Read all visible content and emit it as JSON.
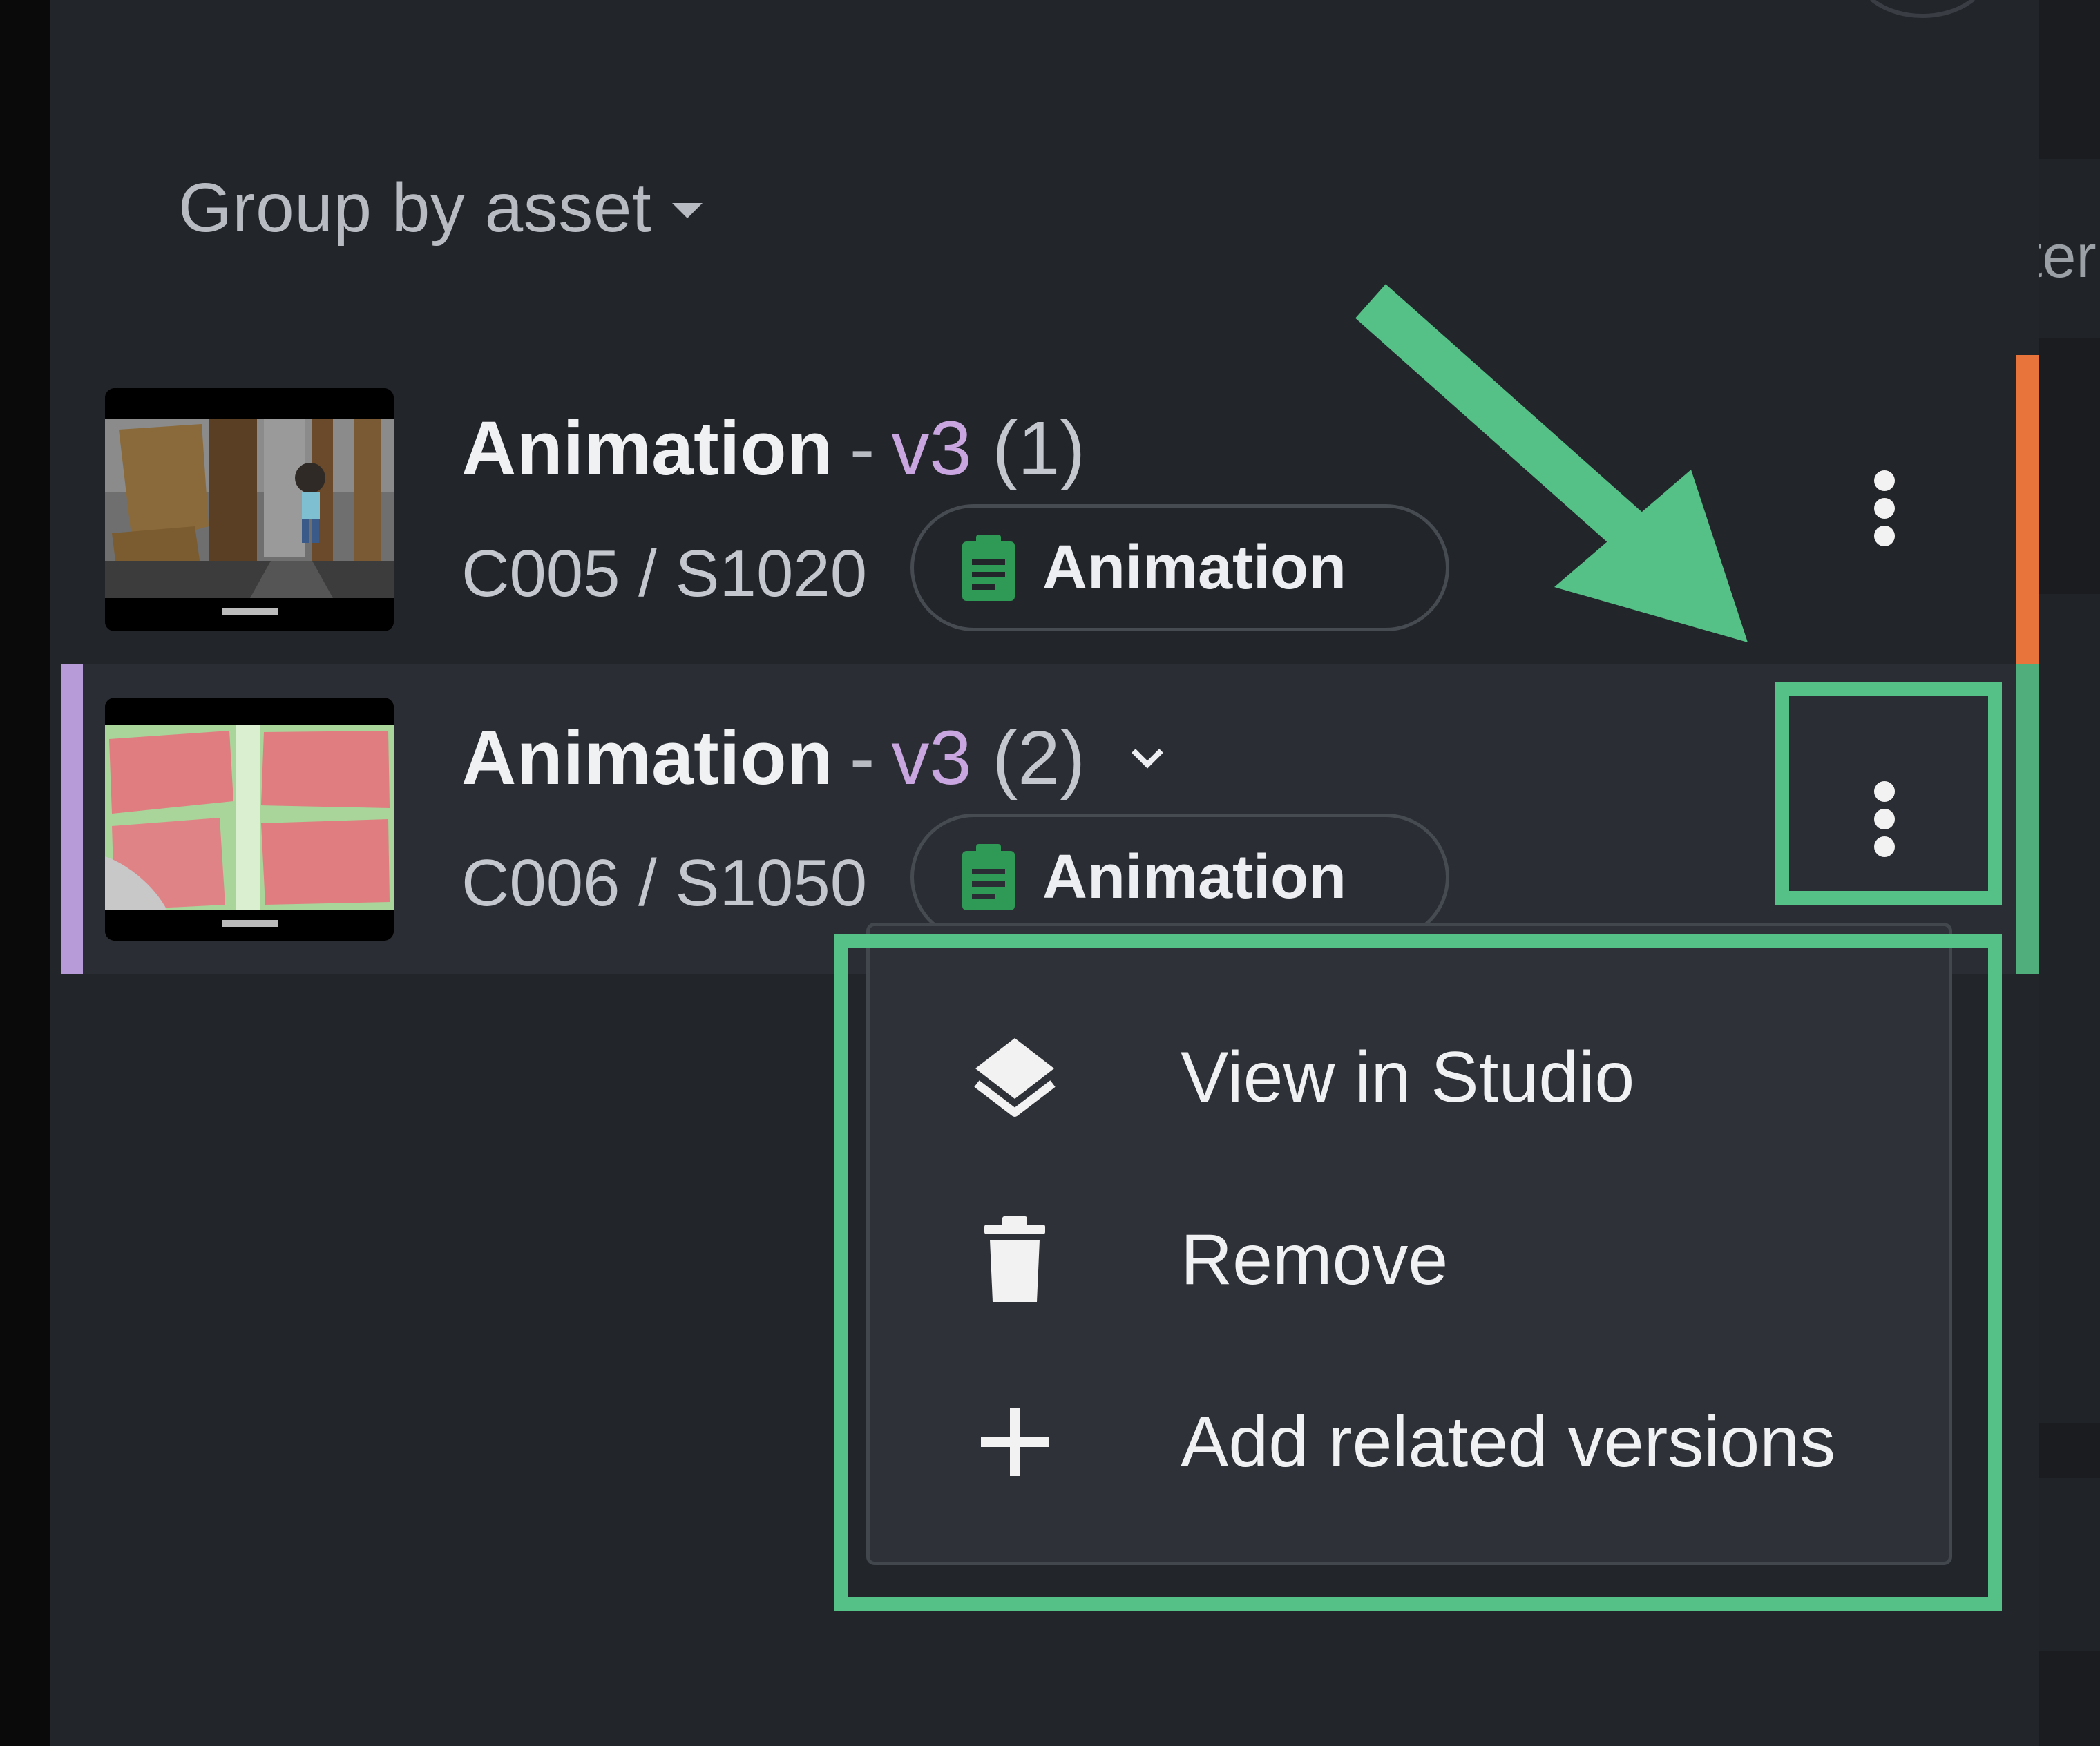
{
  "panel": {
    "group_by": {
      "label": "Group by asset"
    }
  },
  "versions": [
    {
      "title": "Animation",
      "version": "v3",
      "count": "(1)",
      "code": "C005 / S1020",
      "task_label": "Animation",
      "accent_color": "#e8743b"
    },
    {
      "title": "Animation",
      "version": "v3",
      "count": "(2)",
      "code": "C006 / S1050",
      "task_label": "Animation",
      "accent_color": "#b79ad8",
      "expanded_chevron": "chevron-down-icon"
    }
  ],
  "context_menu": {
    "items": [
      {
        "label": "View in Studio",
        "icon": "layers-icon"
      },
      {
        "label": "Remove",
        "icon": "trash-icon"
      },
      {
        "label": "Add related versions",
        "icon": "plus-icon"
      }
    ]
  },
  "right_strip": {
    "peek_text": "ter"
  },
  "colors": {
    "background": "#22252a",
    "selected_row": "#2a2e34",
    "annotation": "#55c186",
    "version_purple": "#c9a6e0",
    "task_green": "#2e9a55",
    "row1_marker": "#e8743b",
    "row2_marker": "#4fae7b"
  }
}
